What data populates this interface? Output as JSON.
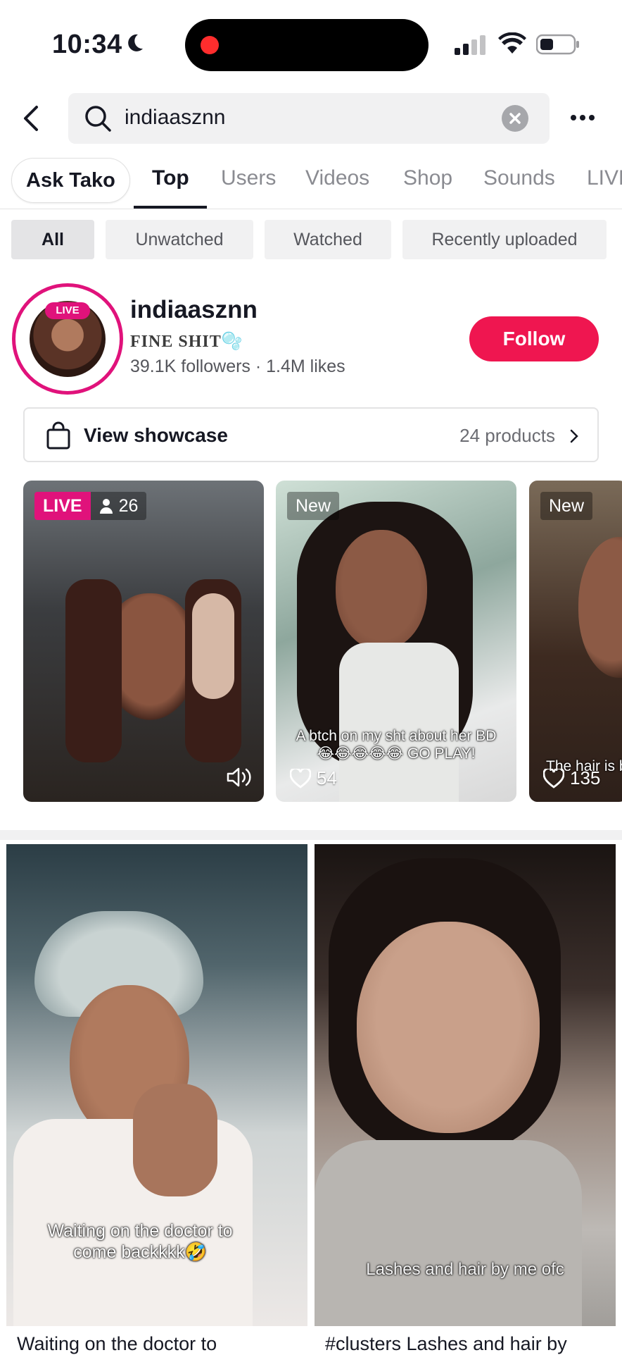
{
  "status_bar": {
    "time": "10:34"
  },
  "search": {
    "query": "indiaasznn"
  },
  "tabs": {
    "ask_tako": "Ask Tako",
    "items": [
      "Top",
      "Users",
      "Videos",
      "Shop",
      "Sounds",
      "LIVE"
    ],
    "active": "Top"
  },
  "filters": [
    "All",
    "Unwatched",
    "Watched",
    "Recently uploaded"
  ],
  "profile": {
    "live_tag": "LIVE",
    "username": "indiaasznn",
    "bio": "FINE SHIT🫧",
    "stats": "39.1K followers · 1.4M likes",
    "follow_label": "Follow"
  },
  "showcase": {
    "label": "View showcase",
    "count": "24 products"
  },
  "cards": [
    {
      "badge": "LIVE",
      "viewers": "26"
    },
    {
      "badge": "New",
      "caption_line1": "A btch on my sht about her BD",
      "caption_line2": "😂😂😂😂😂 GO PLAY!",
      "likes": "54"
    },
    {
      "badge": "New",
      "caption": "The hair is b",
      "likes": "135"
    }
  ],
  "grid": [
    {
      "overlay_line1": "Waiting on the doctor to",
      "overlay_line2": "come backkkk🤣",
      "title": "Waiting on the doctor to"
    },
    {
      "overlay": "Lashes and hair by me ofc",
      "title": "#clusters Lashes and hair by"
    }
  ],
  "colors": {
    "brand_red": "#ef1650",
    "live_pink": "#e0127b"
  }
}
